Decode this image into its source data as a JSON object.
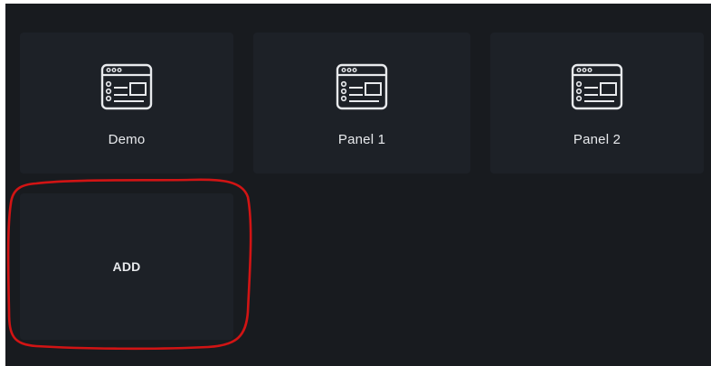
{
  "tiles": [
    {
      "label": "Demo",
      "icon": "dashboard-window-icon"
    },
    {
      "label": "Panel 1",
      "icon": "dashboard-window-icon"
    },
    {
      "label": "Panel 2",
      "icon": "dashboard-window-icon"
    }
  ],
  "add_tile": {
    "label": "ADD"
  },
  "colors": {
    "background": "#181b1f",
    "tile": "#1d2127",
    "text": "#e8eaed",
    "annotation": "#d11414"
  }
}
